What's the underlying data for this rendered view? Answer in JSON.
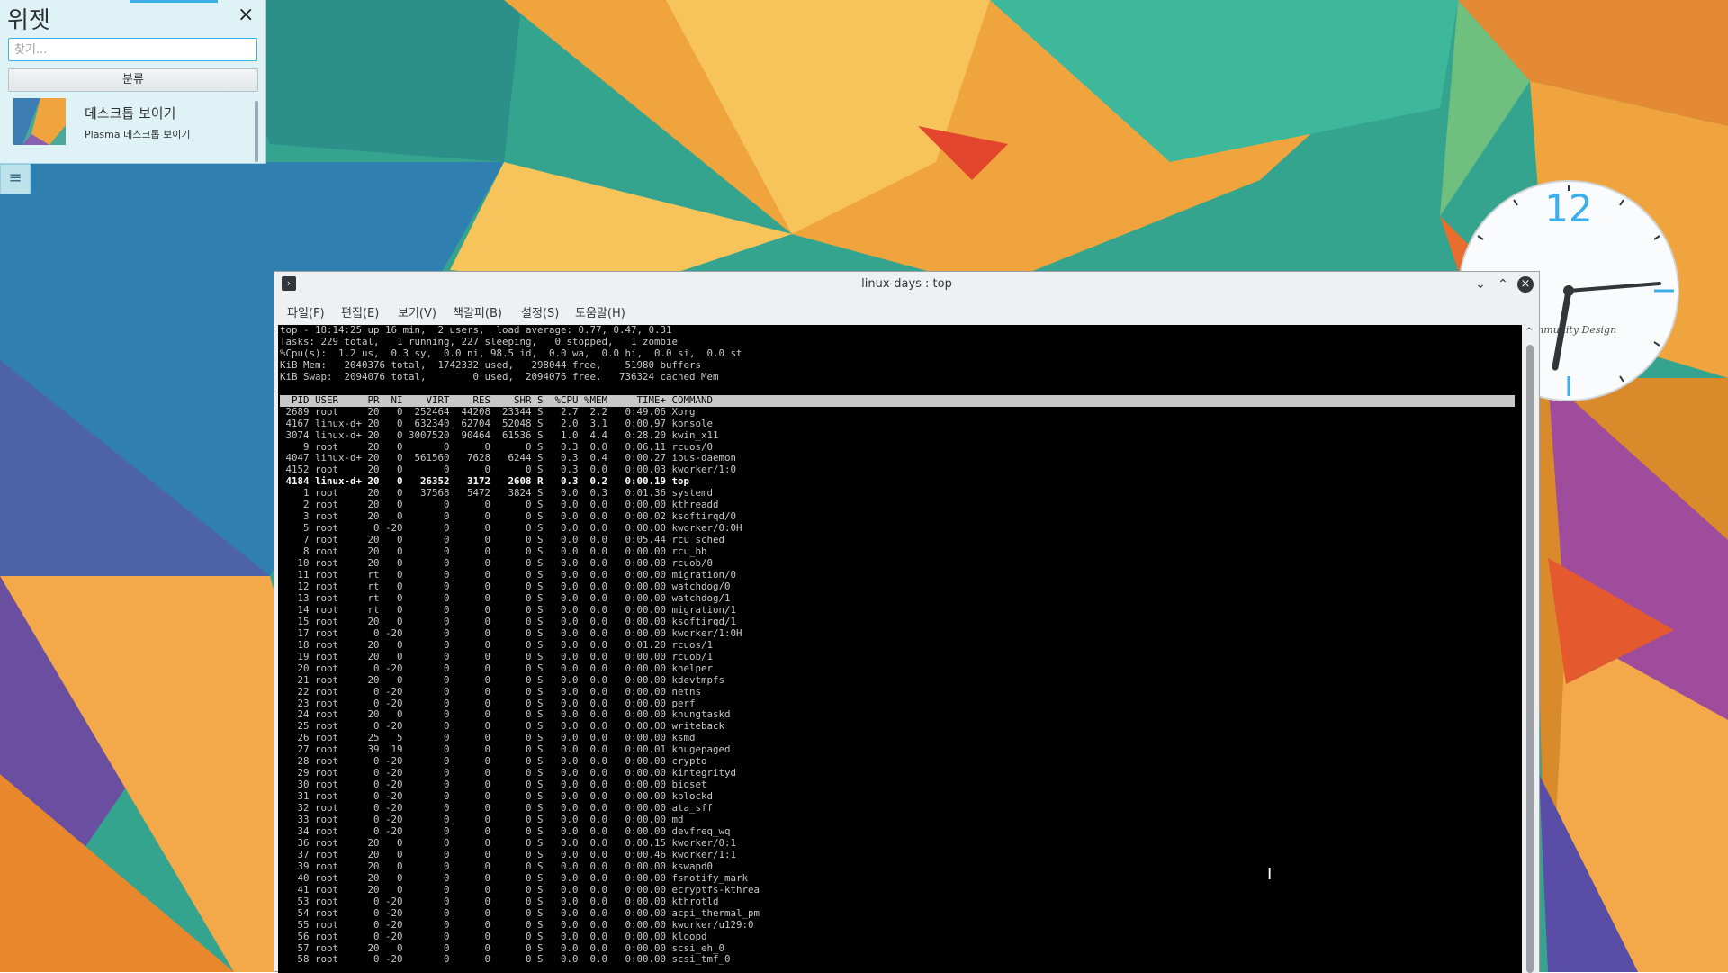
{
  "colors": {
    "accent": "#3daee9",
    "terminal_bg": "#000000",
    "terminal_fg": "#c8c8c8"
  },
  "widget_panel": {
    "title": "위젯",
    "search_placeholder": "찾기...",
    "category_button": "분류",
    "close_icon": "close-icon",
    "items": [
      {
        "name": "데스크톱 보이기",
        "description": "Plasma 데스크톱 보이기",
        "icon": "desktop-thumbnail"
      }
    ]
  },
  "dock_button_icon": "hamburger-menu-icon",
  "clock": {
    "numeral": "12",
    "caption": "Community Design"
  },
  "konsole": {
    "title": "linux-days : top",
    "icon": "terminal-icon",
    "buttons": {
      "minimize": "minimize-icon",
      "maximize": "maximize-icon",
      "close": "close-icon"
    },
    "menu": [
      "파일(F)",
      "편집(E)",
      "보기(V)",
      "책갈피(B)",
      "설정(S)",
      "도움말(H)"
    ],
    "summary": [
      "top - 18:14:25 up 16 min,  2 users,  load average: 0.77, 0.47, 0.31",
      "Tasks: 229 total,   1 running, 227 sleeping,   0 stopped,   1 zombie",
      "%Cpu(s):  1.2 us,  0.3 sy,  0.0 ni, 98.5 id,  0.0 wa,  0.0 hi,  0.0 si,  0.0 st",
      "KiB Mem:   2040376 total,  1742332 used,   298044 free,    51980 buffers",
      "KiB Swap:  2094076 total,        0 used,  2094076 free.   736324 cached Mem"
    ],
    "columns": [
      "PID",
      "USER",
      "PR",
      "NI",
      "VIRT",
      "RES",
      "SHR",
      "S",
      "%CPU",
      "%MEM",
      "TIME+",
      "COMMAND"
    ],
    "processes": [
      [
        "2689",
        "root",
        "20",
        "0",
        "252464",
        "44208",
        "23344",
        "S",
        "2.7",
        "2.2",
        "0:49.06",
        "Xorg"
      ],
      [
        "4167",
        "linux-d+",
        "20",
        "0",
        "632340",
        "62704",
        "52048",
        "S",
        "2.0",
        "3.1",
        "0:00.97",
        "konsole"
      ],
      [
        "3074",
        "linux-d+",
        "20",
        "0",
        "3007520",
        "90464",
        "61536",
        "S",
        "1.0",
        "4.4",
        "0:28.20",
        "kwin_x11"
      ],
      [
        "9",
        "root",
        "20",
        "0",
        "0",
        "0",
        "0",
        "S",
        "0.3",
        "0.0",
        "0:06.11",
        "rcuos/0"
      ],
      [
        "4047",
        "linux-d+",
        "20",
        "0",
        "561560",
        "7628",
        "6244",
        "S",
        "0.3",
        "0.4",
        "0:00.27",
        "ibus-daemon"
      ],
      [
        "4152",
        "root",
        "20",
        "0",
        "0",
        "0",
        "0",
        "S",
        "0.3",
        "0.0",
        "0:00.03",
        "kworker/1:0"
      ],
      [
        "4184",
        "linux-d+",
        "20",
        "0",
        "26352",
        "3172",
        "2608",
        "R",
        "0.3",
        "0.2",
        "0:00.19",
        "top"
      ],
      [
        "1",
        "root",
        "20",
        "0",
        "37568",
        "5472",
        "3824",
        "S",
        "0.0",
        "0.3",
        "0:01.36",
        "systemd"
      ],
      [
        "2",
        "root",
        "20",
        "0",
        "0",
        "0",
        "0",
        "S",
        "0.0",
        "0.0",
        "0:00.00",
        "kthreadd"
      ],
      [
        "3",
        "root",
        "20",
        "0",
        "0",
        "0",
        "0",
        "S",
        "0.0",
        "0.0",
        "0:00.02",
        "ksoftirqd/0"
      ],
      [
        "5",
        "root",
        "0",
        "-20",
        "0",
        "0",
        "0",
        "S",
        "0.0",
        "0.0",
        "0:00.00",
        "kworker/0:0H"
      ],
      [
        "7",
        "root",
        "20",
        "0",
        "0",
        "0",
        "0",
        "S",
        "0.0",
        "0.0",
        "0:05.44",
        "rcu_sched"
      ],
      [
        "8",
        "root",
        "20",
        "0",
        "0",
        "0",
        "0",
        "S",
        "0.0",
        "0.0",
        "0:00.00",
        "rcu_bh"
      ],
      [
        "10",
        "root",
        "20",
        "0",
        "0",
        "0",
        "0",
        "S",
        "0.0",
        "0.0",
        "0:00.00",
        "rcuob/0"
      ],
      [
        "11",
        "root",
        "rt",
        "0",
        "0",
        "0",
        "0",
        "S",
        "0.0",
        "0.0",
        "0:00.00",
        "migration/0"
      ],
      [
        "12",
        "root",
        "rt",
        "0",
        "0",
        "0",
        "0",
        "S",
        "0.0",
        "0.0",
        "0:00.00",
        "watchdog/0"
      ],
      [
        "13",
        "root",
        "rt",
        "0",
        "0",
        "0",
        "0",
        "S",
        "0.0",
        "0.0",
        "0:00.00",
        "watchdog/1"
      ],
      [
        "14",
        "root",
        "rt",
        "0",
        "0",
        "0",
        "0",
        "S",
        "0.0",
        "0.0",
        "0:00.00",
        "migration/1"
      ],
      [
        "15",
        "root",
        "20",
        "0",
        "0",
        "0",
        "0",
        "S",
        "0.0",
        "0.0",
        "0:00.00",
        "ksoftirqd/1"
      ],
      [
        "17",
        "root",
        "0",
        "-20",
        "0",
        "0",
        "0",
        "S",
        "0.0",
        "0.0",
        "0:00.00",
        "kworker/1:0H"
      ],
      [
        "18",
        "root",
        "20",
        "0",
        "0",
        "0",
        "0",
        "S",
        "0.0",
        "0.0",
        "0:01.20",
        "rcuos/1"
      ],
      [
        "19",
        "root",
        "20",
        "0",
        "0",
        "0",
        "0",
        "S",
        "0.0",
        "0.0",
        "0:00.00",
        "rcuob/1"
      ],
      [
        "20",
        "root",
        "0",
        "-20",
        "0",
        "0",
        "0",
        "S",
        "0.0",
        "0.0",
        "0:00.00",
        "khelper"
      ],
      [
        "21",
        "root",
        "20",
        "0",
        "0",
        "0",
        "0",
        "S",
        "0.0",
        "0.0",
        "0:00.00",
        "kdevtmpfs"
      ],
      [
        "22",
        "root",
        "0",
        "-20",
        "0",
        "0",
        "0",
        "S",
        "0.0",
        "0.0",
        "0:00.00",
        "netns"
      ],
      [
        "23",
        "root",
        "0",
        "-20",
        "0",
        "0",
        "0",
        "S",
        "0.0",
        "0.0",
        "0:00.00",
        "perf"
      ],
      [
        "24",
        "root",
        "20",
        "0",
        "0",
        "0",
        "0",
        "S",
        "0.0",
        "0.0",
        "0:00.00",
        "khungtaskd"
      ],
      [
        "25",
        "root",
        "0",
        "-20",
        "0",
        "0",
        "0",
        "S",
        "0.0",
        "0.0",
        "0:00.00",
        "writeback"
      ],
      [
        "26",
        "root",
        "25",
        "5",
        "0",
        "0",
        "0",
        "S",
        "0.0",
        "0.0",
        "0:00.00",
        "ksmd"
      ],
      [
        "27",
        "root",
        "39",
        "19",
        "0",
        "0",
        "0",
        "S",
        "0.0",
        "0.0",
        "0:00.01",
        "khugepaged"
      ],
      [
        "28",
        "root",
        "0",
        "-20",
        "0",
        "0",
        "0",
        "S",
        "0.0",
        "0.0",
        "0:00.00",
        "crypto"
      ],
      [
        "29",
        "root",
        "0",
        "-20",
        "0",
        "0",
        "0",
        "S",
        "0.0",
        "0.0",
        "0:00.00",
        "kintegrityd"
      ],
      [
        "30",
        "root",
        "0",
        "-20",
        "0",
        "0",
        "0",
        "S",
        "0.0",
        "0.0",
        "0:00.00",
        "bioset"
      ],
      [
        "31",
        "root",
        "0",
        "-20",
        "0",
        "0",
        "0",
        "S",
        "0.0",
        "0.0",
        "0:00.00",
        "kblockd"
      ],
      [
        "32",
        "root",
        "0",
        "-20",
        "0",
        "0",
        "0",
        "S",
        "0.0",
        "0.0",
        "0:00.00",
        "ata_sff"
      ],
      [
        "33",
        "root",
        "0",
        "-20",
        "0",
        "0",
        "0",
        "S",
        "0.0",
        "0.0",
        "0:00.00",
        "md"
      ],
      [
        "34",
        "root",
        "0",
        "-20",
        "0",
        "0",
        "0",
        "S",
        "0.0",
        "0.0",
        "0:00.00",
        "devfreq_wq"
      ],
      [
        "36",
        "root",
        "20",
        "0",
        "0",
        "0",
        "0",
        "S",
        "0.0",
        "0.0",
        "0:00.15",
        "kworker/0:1"
      ],
      [
        "37",
        "root",
        "20",
        "0",
        "0",
        "0",
        "0",
        "S",
        "0.0",
        "0.0",
        "0:00.46",
        "kworker/1:1"
      ],
      [
        "39",
        "root",
        "20",
        "0",
        "0",
        "0",
        "0",
        "S",
        "0.0",
        "0.0",
        "0:00.00",
        "kswapd0"
      ],
      [
        "40",
        "root",
        "20",
        "0",
        "0",
        "0",
        "0",
        "S",
        "0.0",
        "0.0",
        "0:00.00",
        "fsnotify_mark"
      ],
      [
        "41",
        "root",
        "20",
        "0",
        "0",
        "0",
        "0",
        "S",
        "0.0",
        "0.0",
        "0:00.00",
        "ecryptfs-kthrea"
      ],
      [
        "53",
        "root",
        "0",
        "-20",
        "0",
        "0",
        "0",
        "S",
        "0.0",
        "0.0",
        "0:00.00",
        "kthrotld"
      ],
      [
        "54",
        "root",
        "0",
        "-20",
        "0",
        "0",
        "0",
        "S",
        "0.0",
        "0.0",
        "0:00.00",
        "acpi_thermal_pm"
      ],
      [
        "55",
        "root",
        "0",
        "-20",
        "0",
        "0",
        "0",
        "S",
        "0.0",
        "0.0",
        "0:00.00",
        "kworker/u129:0"
      ],
      [
        "56",
        "root",
        "0",
        "-20",
        "0",
        "0",
        "0",
        "S",
        "0.0",
        "0.0",
        "0:00.00",
        "kloopd"
      ],
      [
        "57",
        "root",
        "20",
        "0",
        "0",
        "0",
        "0",
        "S",
        "0.0",
        "0.0",
        "0:00.00",
        "scsi_eh_0"
      ],
      [
        "58",
        "root",
        "0",
        "-20",
        "0",
        "0",
        "0",
        "S",
        "0.0",
        "0.0",
        "0:00.00",
        "scsi_tmf_0"
      ]
    ]
  }
}
